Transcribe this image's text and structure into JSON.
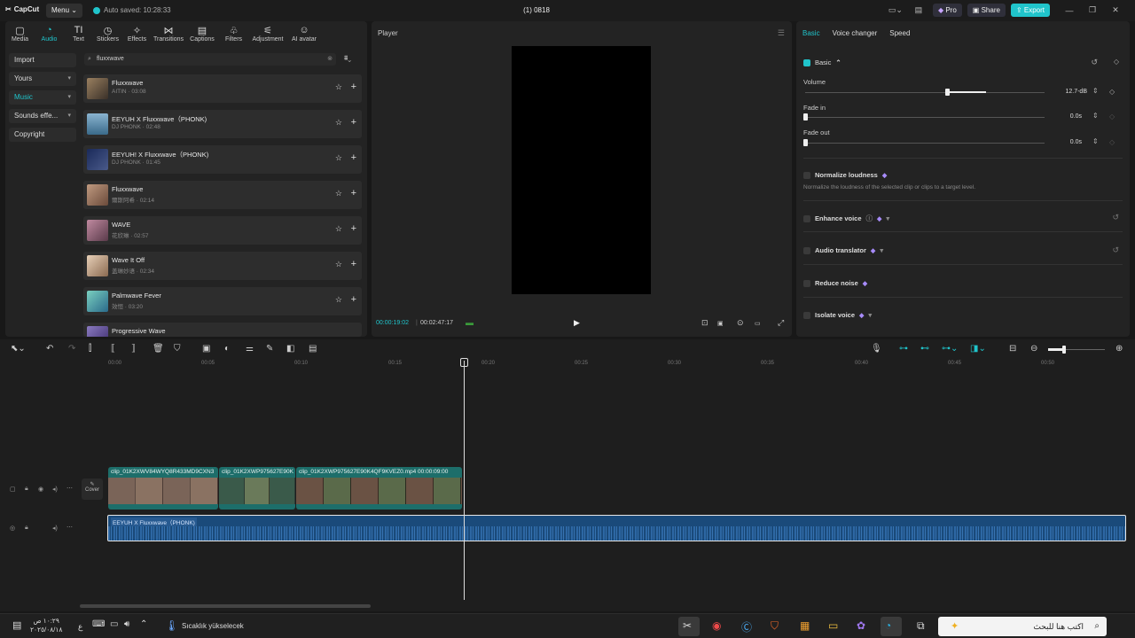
{
  "app": {
    "logo": "CapCut",
    "menu_label": "Menu",
    "autosave": "Auto saved: 10:28:33",
    "project_title": "(1) 0818",
    "pro_label": "Pro",
    "share_label": "Share",
    "export_label": "Export"
  },
  "toolbar": {
    "tabs": [
      {
        "label": "Media",
        "icon": "▢"
      },
      {
        "label": "Audio",
        "icon": "◔"
      },
      {
        "label": "Text",
        "icon": "TI"
      },
      {
        "label": "Stickers",
        "icon": "◷"
      },
      {
        "label": "Effects",
        "icon": "✧"
      },
      {
        "label": "Transitions",
        "icon": "⋈"
      },
      {
        "label": "Captions",
        "icon": "▤"
      },
      {
        "label": "Filters",
        "icon": "♧"
      },
      {
        "label": "Adjustment",
        "icon": "⚟"
      },
      {
        "label": "AI avatar",
        "icon": "☺"
      }
    ],
    "active_tab": "Audio"
  },
  "sidebar": {
    "items": [
      {
        "label": "Import"
      },
      {
        "label": "Yours"
      },
      {
        "label": "Music"
      },
      {
        "label": "Sounds effe..."
      },
      {
        "label": "Copyright"
      }
    ],
    "active": "Music"
  },
  "search": {
    "value": "fluxxwave"
  },
  "tracks": [
    {
      "title": "Fluxxwave",
      "subtitle": "AITIN · 03:08",
      "color": "#6b5a4a"
    },
    {
      "title": "EEYUH X Fluxxwave（PHONK)",
      "subtitle": "DJ PHONK · 02:48",
      "color": "#4a7a9a"
    },
    {
      "title": "EEYUH! X Fluxxwave（PHONK)",
      "subtitle": "DJ PHONK · 01:45",
      "color": "#2a3a6a"
    },
    {
      "title": "Fluxxwave",
      "subtitle": "爾斯阿希 · 02:14",
      "color": "#8a6a5a"
    },
    {
      "title": "WAVE",
      "subtitle": "花欣琳 · 02:57",
      "color": "#7a4a5a"
    },
    {
      "title": "Wave It Off",
      "subtitle": "盖琳妙语 · 02:34",
      "color": "#b89a7a"
    },
    {
      "title": "Palmwave Fever",
      "subtitle": "效恒 · 03:20",
      "color": "#3a8a7a"
    },
    {
      "title": "Progressive Wave",
      "subtitle": "",
      "color": "#5a4a8a"
    }
  ],
  "player": {
    "title": "Player",
    "current_time": "00:00:19:02",
    "total_time": "00:02:47:17"
  },
  "right_panel": {
    "tabs": [
      "Basic",
      "Voice changer",
      "Speed"
    ],
    "active_tab": "Basic",
    "section_label": "Basic",
    "volume": {
      "label": "Volume",
      "value": "12.7-dB",
      "level": 0.78
    },
    "fade_in": {
      "label": "Fade in",
      "value": "0.0s"
    },
    "fade_out": {
      "label": "Fade out",
      "value": "0.0s"
    },
    "normalize": {
      "label": "Normalize loudness",
      "desc": "Normalize the loudness of the selected clip or clips to a target level."
    },
    "enhance": {
      "label": "Enhance voice"
    },
    "translator": {
      "label": "Audio translator"
    },
    "reduce_noise": {
      "label": "Reduce noise"
    },
    "isolate": {
      "label": "Isolate voice"
    }
  },
  "timeline": {
    "ruler": [
      "00:00",
      "00:05",
      "00:10",
      "00:15",
      "00:20",
      "00:25",
      "00:30",
      "00:35",
      "00:40",
      "00:45",
      "00:50"
    ],
    "clips": [
      {
        "label": "clip_01K2XWV84WYQ8R433MD9CXN3"
      },
      {
        "label": "clip_01K2XWP975627E90K"
      },
      {
        "label": "clip_01K2XWP975627E90K4QF9KVEZ0.mp4   00:00:09:00"
      }
    ],
    "cover_label": "Cover",
    "audio_label": "EEYUH X Fluxxwave（PHONK)"
  },
  "taskbar": {
    "time": "١٠:٢٩ ص",
    "date": "٢٠٢٥/٠٨/١٨",
    "weather": "Sıcaklık yükselecek",
    "search_placeholder": "اكتب هنا للبحث"
  }
}
